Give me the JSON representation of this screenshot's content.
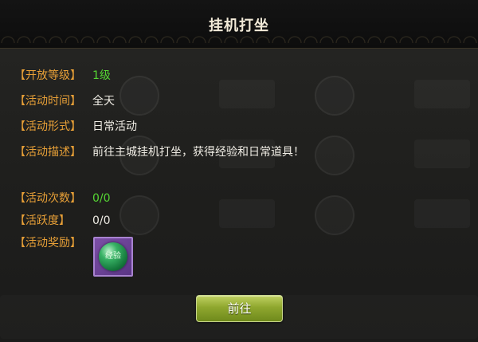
{
  "dialog": {
    "title": "挂机打坐"
  },
  "info_rows": [
    {
      "label": "【开放等级】",
      "value": "1级",
      "highlight": true
    },
    {
      "label": "【活动时间】",
      "value": "全天",
      "highlight": false
    },
    {
      "label": "【活动形式】",
      "value": "日常活动",
      "highlight": false
    },
    {
      "label": "【活动描述】",
      "value": "前往主城挂机打坐，获得经验和日常道具！",
      "highlight": false
    },
    {
      "label": "【活动次数】",
      "value": "0/0",
      "highlight": true
    },
    {
      "label": "【活跃度】",
      "value": "0/0",
      "highlight": false
    },
    {
      "label": "【活动奖励】",
      "value": "",
      "highlight": false
    }
  ],
  "reward": {
    "item_text": "经验",
    "icon": "experience-orb-icon"
  },
  "actions": {
    "go_label": "前往"
  },
  "colors": {
    "label": "#e8a037",
    "value": "#efece4",
    "highlight": "#55d633",
    "button": "#8fa72e"
  }
}
